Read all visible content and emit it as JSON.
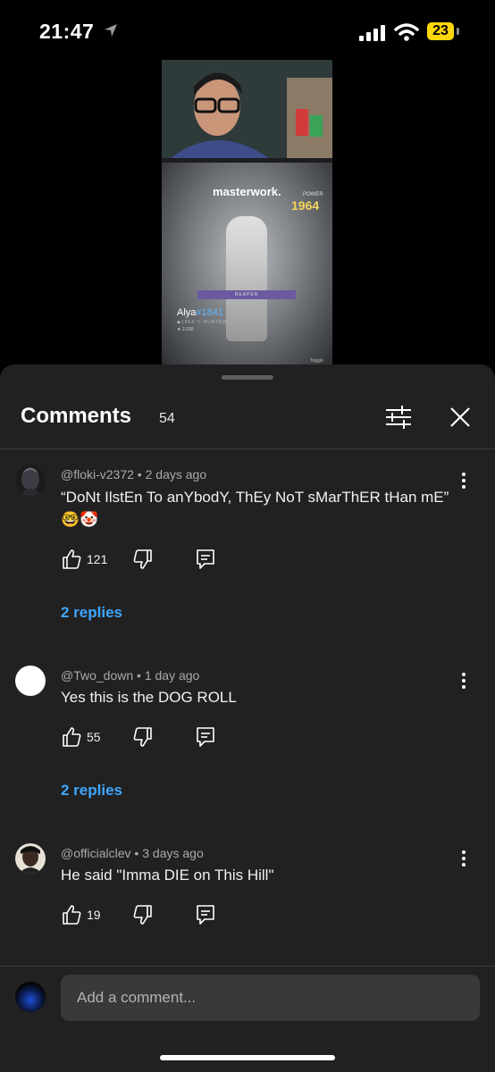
{
  "status_bar": {
    "time": "21:47",
    "battery": "23"
  },
  "video": {
    "masterwork": "masterwork.",
    "power_label": "POWER",
    "power": "1964",
    "reaper_label": "REAPER",
    "player_name": "Alya",
    "player_tag": "#1841",
    "player_sub": "◆1964 // HUNTER",
    "player_score": "★ 2,030",
    "toggle": "Toggle"
  },
  "comments_panel": {
    "title": "Comments",
    "count": "54",
    "comments": [
      {
        "author": "@floki-v2372",
        "age": "2 days ago",
        "text": "“DoNt IlstEn To anYbodY, ThEy NoT sMarThER tHan mE” 🤓🤡",
        "likes": "121",
        "replies": "2 replies"
      },
      {
        "author": "@Two_down",
        "age": "1 day ago",
        "text": "Yes this is the DOG ROLL",
        "likes": "55",
        "replies": "2 replies"
      },
      {
        "author": "@officialclev",
        "age": "3 days ago",
        "text": "He said \"Imma DIE on This Hill\"",
        "likes": "19"
      }
    ],
    "add_comment_placeholder": "Add a comment..."
  },
  "colors": {
    "accent_link": "#3ea6ff",
    "battery": "#ffd60a",
    "sheet": "#212121"
  }
}
